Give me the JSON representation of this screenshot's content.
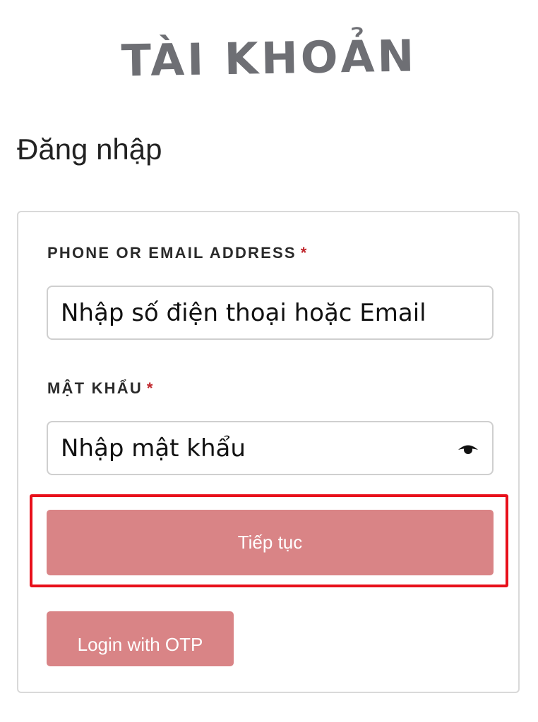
{
  "header": {
    "title": "TÀI KHOẢN"
  },
  "login": {
    "heading": "Đăng nhập",
    "identifier_label": "PHONE OR EMAIL ADDRESS",
    "identifier_placeholder": "Nhập số điện thoại hoặc Email",
    "password_label": "MẬT KHẨU",
    "password_placeholder": "Nhập mật khẩu",
    "required_marker": "*",
    "password_toggle_icon": "eye-icon",
    "continue_label": "Tiếp tục",
    "otp_label": "Login with OTP"
  },
  "colors": {
    "title_gray": "#6e6f74",
    "button_pink": "#d98486",
    "required_red": "#c0272d",
    "highlight_red": "#e8101b"
  }
}
